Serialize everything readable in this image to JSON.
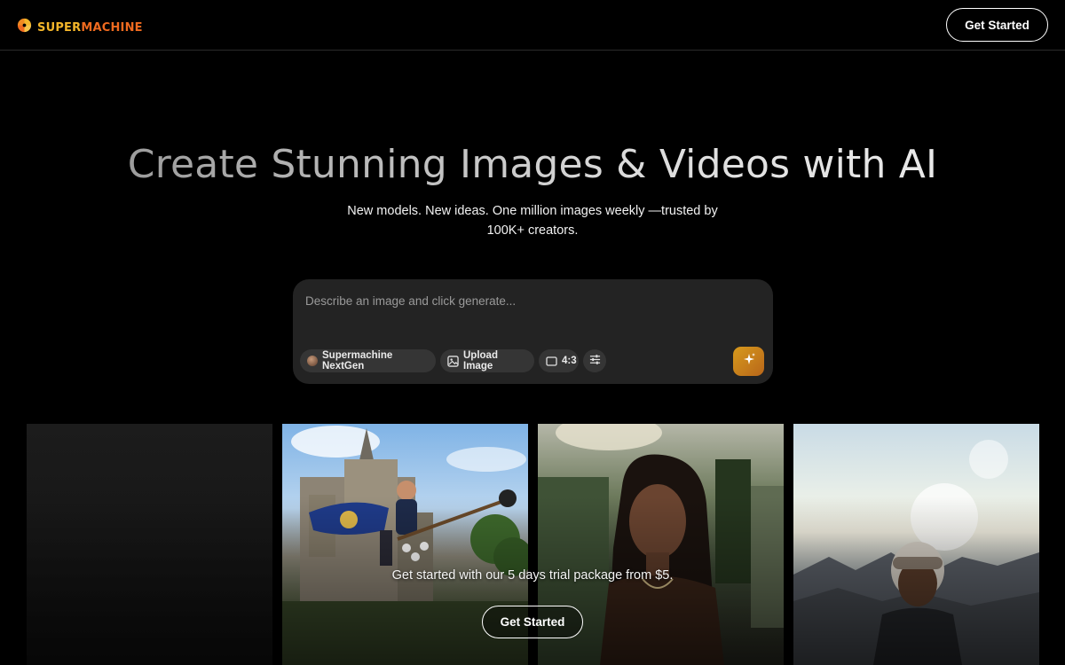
{
  "header": {
    "logo_part1": "SUPER",
    "logo_part2": "MACHINE",
    "cta_label": "Get Started"
  },
  "hero": {
    "title": "Create Stunning Images & Videos with AI",
    "subtitle": "New models. New ideas. One million images weekly —trusted by 100K+ creators."
  },
  "prompt": {
    "placeholder": "Describe an image and click generate...",
    "value": "",
    "model_label": "Supermachine NextGen",
    "upload_label": "Upload Image",
    "ratio_label": "4:3",
    "settings_icon": "sliders-icon",
    "generate_icon": "sparkle-icon"
  },
  "gallery": {
    "tiles": [
      {
        "subject": "empty-dark"
      },
      {
        "subject": "boy-flying-broom-castle"
      },
      {
        "subject": "woman-portrait-garden"
      },
      {
        "subject": "woman-snow-mountains"
      }
    ]
  },
  "cta": {
    "text": "Get started with our 5 days trial package from $5.",
    "button_label": "Get Started"
  },
  "colors": {
    "background": "#000000",
    "logo_yellow": "#f3b52a",
    "logo_orange": "#ef6a1f",
    "generate_gradient_start": "#d79a1c",
    "generate_gradient_end": "#b8661a",
    "prompt_box": "#232323"
  }
}
